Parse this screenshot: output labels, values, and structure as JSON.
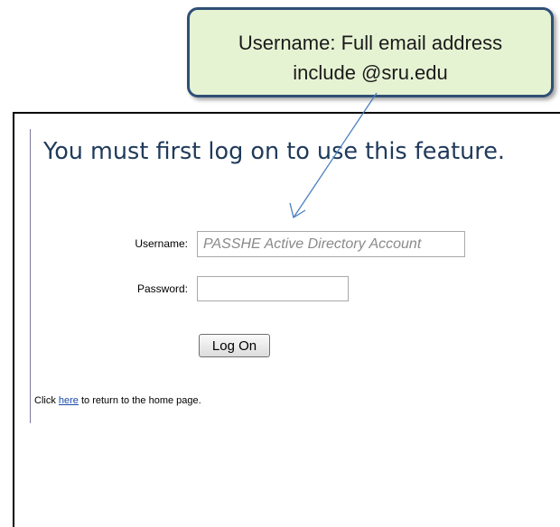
{
  "callout": {
    "line1": "Username:  Full email address",
    "line2": "include @sru.edu"
  },
  "login": {
    "headline": "You must first log on to use this feature.",
    "username_label": "Username:",
    "username_placeholder": "PASSHE Active Directory Account",
    "password_label": "Password:",
    "logon_button": "Log On"
  },
  "footer": {
    "prefix": "Click ",
    "link": "here",
    "suffix": " to return to the home page."
  },
  "colors": {
    "callout_fill": "#e6f3d3",
    "callout_border": "#2f4f75",
    "arrow": "#4a7fc0",
    "headline": "#1f3a5a",
    "link": "#1a4aa8"
  }
}
